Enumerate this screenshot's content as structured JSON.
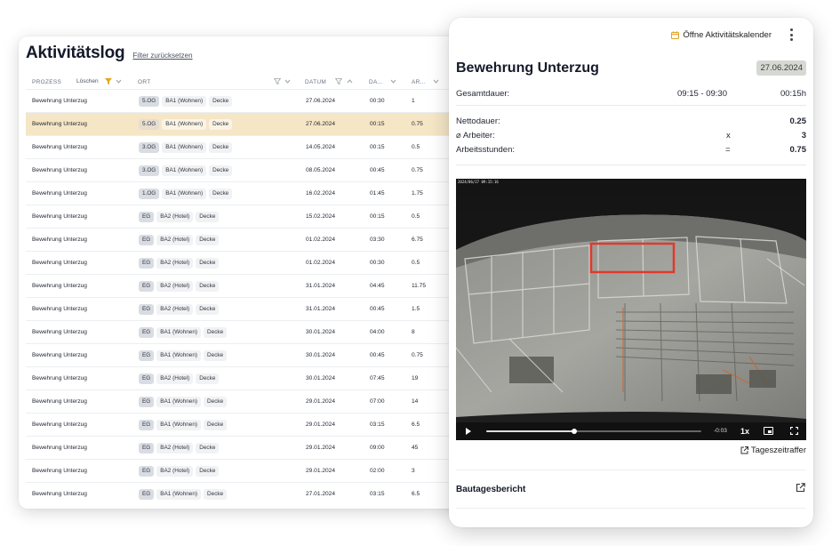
{
  "log": {
    "title": "Aktivitätslog",
    "filter_reset": "Filter zurücksetzen",
    "columns": {
      "prozess": "PROZESS",
      "loeschen": "Löschen",
      "ort": "ORT",
      "datum": "DATUM",
      "dauer": "DA...",
      "ar": "AR..."
    },
    "rows": [
      {
        "process": "Bewehrung Unterzug",
        "level": "5.OG",
        "area": "BA1 (Wohnen)",
        "element": "Decke",
        "date": "27.06.2024",
        "duration": "00:30",
        "ar": "1",
        "selected": false
      },
      {
        "process": "Bewehrung Unterzug",
        "level": "5.OG",
        "area": "BA1 (Wohnen)",
        "element": "Decke",
        "date": "27.06.2024",
        "duration": "00:15",
        "ar": "0.75",
        "selected": true
      },
      {
        "process": "Bewehrung Unterzug",
        "level": "3.OG",
        "area": "BA1 (Wohnen)",
        "element": "Decke",
        "date": "14.05.2024",
        "duration": "00:15",
        "ar": "0.5",
        "selected": false
      },
      {
        "process": "Bewehrung Unterzug",
        "level": "3.OG",
        "area": "BA1 (Wohnen)",
        "element": "Decke",
        "date": "08.05.2024",
        "duration": "00:45",
        "ar": "0.75",
        "selected": false
      },
      {
        "process": "Bewehrung Unterzug",
        "level": "1.OG",
        "area": "BA1 (Wohnen)",
        "element": "Decke",
        "date": "16.02.2024",
        "duration": "01:45",
        "ar": "1.75",
        "selected": false
      },
      {
        "process": "Bewehrung Unterzug",
        "level": "EG",
        "area": "BA2 (Hotel)",
        "element": "Decke",
        "date": "15.02.2024",
        "duration": "00:15",
        "ar": "0.5",
        "selected": false
      },
      {
        "process": "Bewehrung Unterzug",
        "level": "EG",
        "area": "BA2 (Hotel)",
        "element": "Decke",
        "date": "01.02.2024",
        "duration": "03:30",
        "ar": "6.75",
        "selected": false
      },
      {
        "process": "Bewehrung Unterzug",
        "level": "EG",
        "area": "BA2 (Hotel)",
        "element": "Decke",
        "date": "01.02.2024",
        "duration": "00:30",
        "ar": "0.5",
        "selected": false
      },
      {
        "process": "Bewehrung Unterzug",
        "level": "EG",
        "area": "BA2 (Hotel)",
        "element": "Decke",
        "date": "31.01.2024",
        "duration": "04:45",
        "ar": "11.75",
        "selected": false
      },
      {
        "process": "Bewehrung Unterzug",
        "level": "EG",
        "area": "BA2 (Hotel)",
        "element": "Decke",
        "date": "31.01.2024",
        "duration": "00:45",
        "ar": "1.5",
        "selected": false
      },
      {
        "process": "Bewehrung Unterzug",
        "level": "EG",
        "area": "BA1 (Wohnen)",
        "element": "Decke",
        "date": "30.01.2024",
        "duration": "04:00",
        "ar": "8",
        "selected": false
      },
      {
        "process": "Bewehrung Unterzug",
        "level": "EG",
        "area": "BA1 (Wohnen)",
        "element": "Decke",
        "date": "30.01.2024",
        "duration": "00:45",
        "ar": "0.75",
        "selected": false
      },
      {
        "process": "Bewehrung Unterzug",
        "level": "EG",
        "area": "BA2 (Hotel)",
        "element": "Decke",
        "date": "30.01.2024",
        "duration": "07:45",
        "ar": "19",
        "selected": false
      },
      {
        "process": "Bewehrung Unterzug",
        "level": "EG",
        "area": "BA1 (Wohnen)",
        "element": "Decke",
        "date": "29.01.2024",
        "duration": "07:00",
        "ar": "14",
        "selected": false
      },
      {
        "process": "Bewehrung Unterzug",
        "level": "EG",
        "area": "BA1 (Wohnen)",
        "element": "Decke",
        "date": "29.01.2024",
        "duration": "03:15",
        "ar": "6.5",
        "selected": false
      },
      {
        "process": "Bewehrung Unterzug",
        "level": "EG",
        "area": "BA2 (Hotel)",
        "element": "Decke",
        "date": "29.01.2024",
        "duration": "09:00",
        "ar": "45",
        "selected": false
      },
      {
        "process": "Bewehrung Unterzug",
        "level": "EG",
        "area": "BA2 (Hotel)",
        "element": "Decke",
        "date": "29.01.2024",
        "duration": "02:00",
        "ar": "3",
        "selected": false
      },
      {
        "process": "Bewehrung Unterzug",
        "level": "EG",
        "area": "BA1 (Wohnen)",
        "element": "Decke",
        "date": "27.01.2024",
        "duration": "03:15",
        "ar": "6.5",
        "selected": false
      }
    ]
  },
  "detail": {
    "open_calendar": "Öffne Aktivitätskalender",
    "title": "Bewehrung Unterzug",
    "date_badge": "27.06.2024",
    "gesamtdauer_label": "Gesamtdauer:",
    "gesamtdauer_range": "09:15 - 09:30",
    "gesamtdauer_value": "00:15h",
    "nettodauer_label": "Nettodauer:",
    "nettodauer_value": "0.25",
    "arbeiter_label": "⌀ Arbeiter:",
    "arbeiter_op": "x",
    "arbeiter_value": "3",
    "arbeitsstunden_label": "Arbeitsstunden:",
    "arbeitsstunden_op": "=",
    "arbeitsstunden_value": "0.75",
    "video": {
      "timestamp": "2024/06/27 09:15:16",
      "time_remaining": "-0:03",
      "speed": "1x",
      "progress": 0.41
    },
    "timelapse_link": "Tageszeitraffer",
    "report_label": "Bautagesbericht"
  },
  "colors": {
    "selected_row": "#f5e6c6",
    "filter_active": "#e8a317",
    "highlight_box": "#e03a2b",
    "date_badge_bg": "#d6d8d3"
  }
}
